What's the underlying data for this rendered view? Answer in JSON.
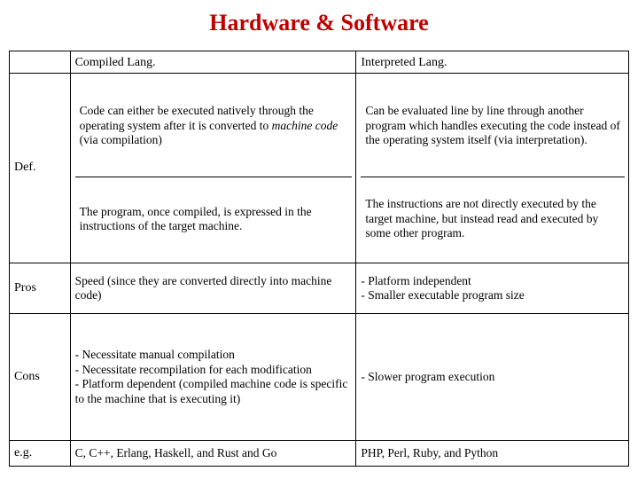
{
  "title": "Hardware & Software",
  "title_color": "#C00000",
  "table": {
    "columns": [
      "",
      "Compiled Lang.",
      "Interpreted Lang."
    ],
    "rows": [
      {
        "label": "Def.",
        "compiled": [
          "Code can either be executed natively through the operating system after it is converted to ",
          "machine code",
          " (via compilation)"
        ],
        "compiled_part2": "The program, once compiled, is expressed in the instructions of the target machine.",
        "interpreted_part1": "Can be evaluated line by line through another program which handles executing the code instead of the operating system itself (via interpretation).",
        "interpreted_part2": "The instructions are not directly executed by the target machine, but instead read and executed by some other program."
      },
      {
        "label": "Pros",
        "compiled": "Speed (since they are converted directly into machine code)",
        "interpreted": "- Platform independent\n- Smaller executable program size"
      },
      {
        "label": "Cons",
        "compiled": "- Necessitate manual compilation\n- Necessitate recompilation for each modification\n- Platform dependent (compiled machine code is specific to the machine that is executing it)",
        "interpreted": "- Slower program execution"
      },
      {
        "label": "e.g.",
        "compiled": "C, C++, Erlang, Haskell, and Rust and Go",
        "interpreted": "PHP, Perl, Ruby, and Python"
      }
    ]
  }
}
